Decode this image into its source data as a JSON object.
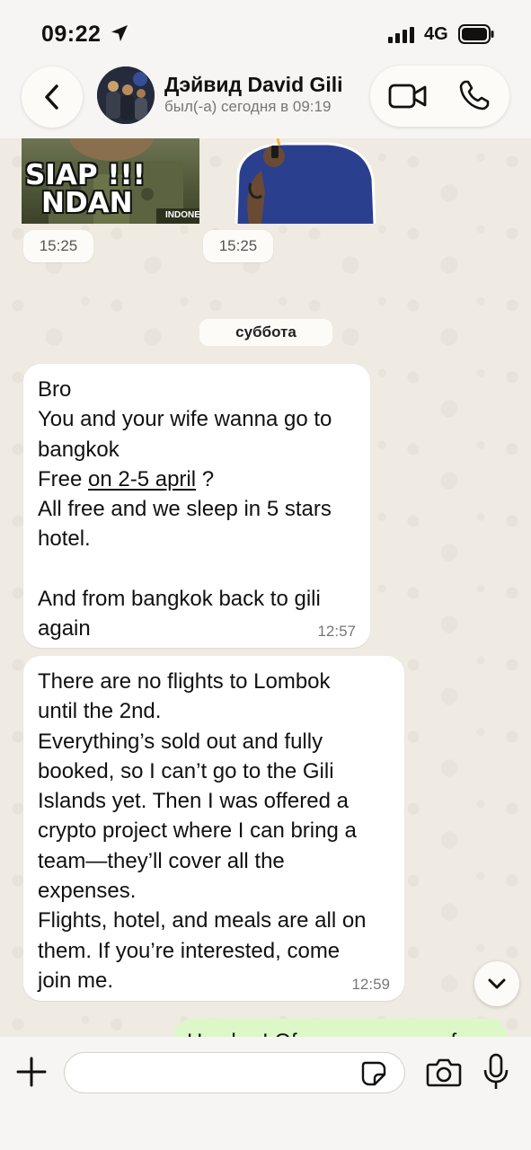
{
  "status_bar": {
    "time": "09:22",
    "network": "4G",
    "icons": [
      "location-arrow-icon",
      "signal-icon",
      "battery-icon"
    ]
  },
  "header": {
    "contact_name": "Дэйвид David Gili",
    "last_seen": "был(-а) сегодня в 09:19",
    "icons": [
      "back-icon",
      "video-call-icon",
      "phone-icon"
    ]
  },
  "chat": {
    "stickers": [
      {
        "caption_line1": "SIAP !!!",
        "caption_line2": "NDAN",
        "badge": "INDONES",
        "time": "15:25"
      },
      {
        "time": "15:25"
      }
    ],
    "date_separator": "суббота",
    "messages": [
      {
        "direction": "incoming",
        "lines": [
          "Bro",
          "You and your wife wanna go to",
          "bangkok"
        ],
        "free_prefix": "Free ",
        "free_link": "on 2-5 april",
        "free_suffix": " ?",
        "lines_after": [
          "All free and we sleep in 5 stars",
          "hotel.",
          "",
          "And from bangkok back to gili",
          "again"
        ],
        "time": "12:57"
      },
      {
        "direction": "incoming",
        "text": "There are no flights to Lombok\nuntil the 2nd.\nEverything’s sold out and fully\nbooked, so I can’t go to the Gili\nIslands yet. Then I was offered a\ncrypto project where I can bring a\nteam—they’ll cover all the\nexpenses.\nFlights, hotel, and meals are all on\nthem. If you’re interested, come\njoin me.",
        "time": "12:59"
      },
      {
        "direction": "outgoing",
        "text": "Hey bro! Of course, we are for"
      }
    ]
  },
  "composer": {
    "input_value": "",
    "input_placeholder": "",
    "icons": [
      "plus-icon",
      "sticker-icon",
      "camera-icon",
      "microphone-icon"
    ]
  },
  "colors": {
    "wallpaper": "#efeae2",
    "bar_background": "#f6f5f3",
    "incoming_bubble": "#ffffff",
    "outgoing_bubble": "#dcf8c6"
  }
}
